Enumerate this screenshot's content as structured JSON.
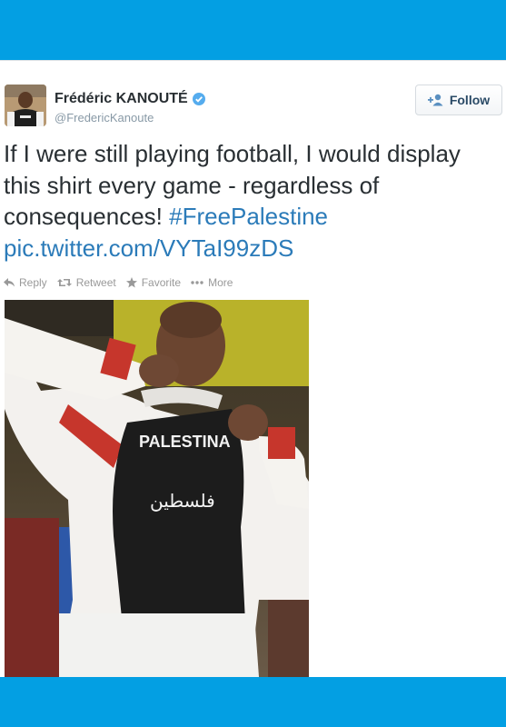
{
  "header": {
    "color": "#039fe3"
  },
  "tweet": {
    "author": {
      "display_name": "Frédéric KANOUTÉ",
      "handle": "@FredericKanoute",
      "verified": true,
      "avatar_icon": "avatar-photo"
    },
    "follow_button": {
      "label": "Follow",
      "icon": "add-user-icon"
    },
    "text": {
      "body": "If I were still playing football, I would display this shirt every game - regardless of consequences! ",
      "hashtag": "#FreePalestine",
      "link": "pic.twitter.com/VYTaI99zDS"
    },
    "actions": [
      {
        "label": "Reply",
        "icon": "reply-icon"
      },
      {
        "label": "Retweet",
        "icon": "retweet-icon"
      },
      {
        "label": "Favorite",
        "icon": "star-icon"
      },
      {
        "label": "More",
        "icon": "more-dots-icon"
      }
    ],
    "media": {
      "shirt_text": "PALESTINA",
      "shirt_arabic": "فلسطين"
    }
  },
  "colors": {
    "accent": "#2b7bb9",
    "top_bar": "#039fe3",
    "muted": "#999999"
  }
}
